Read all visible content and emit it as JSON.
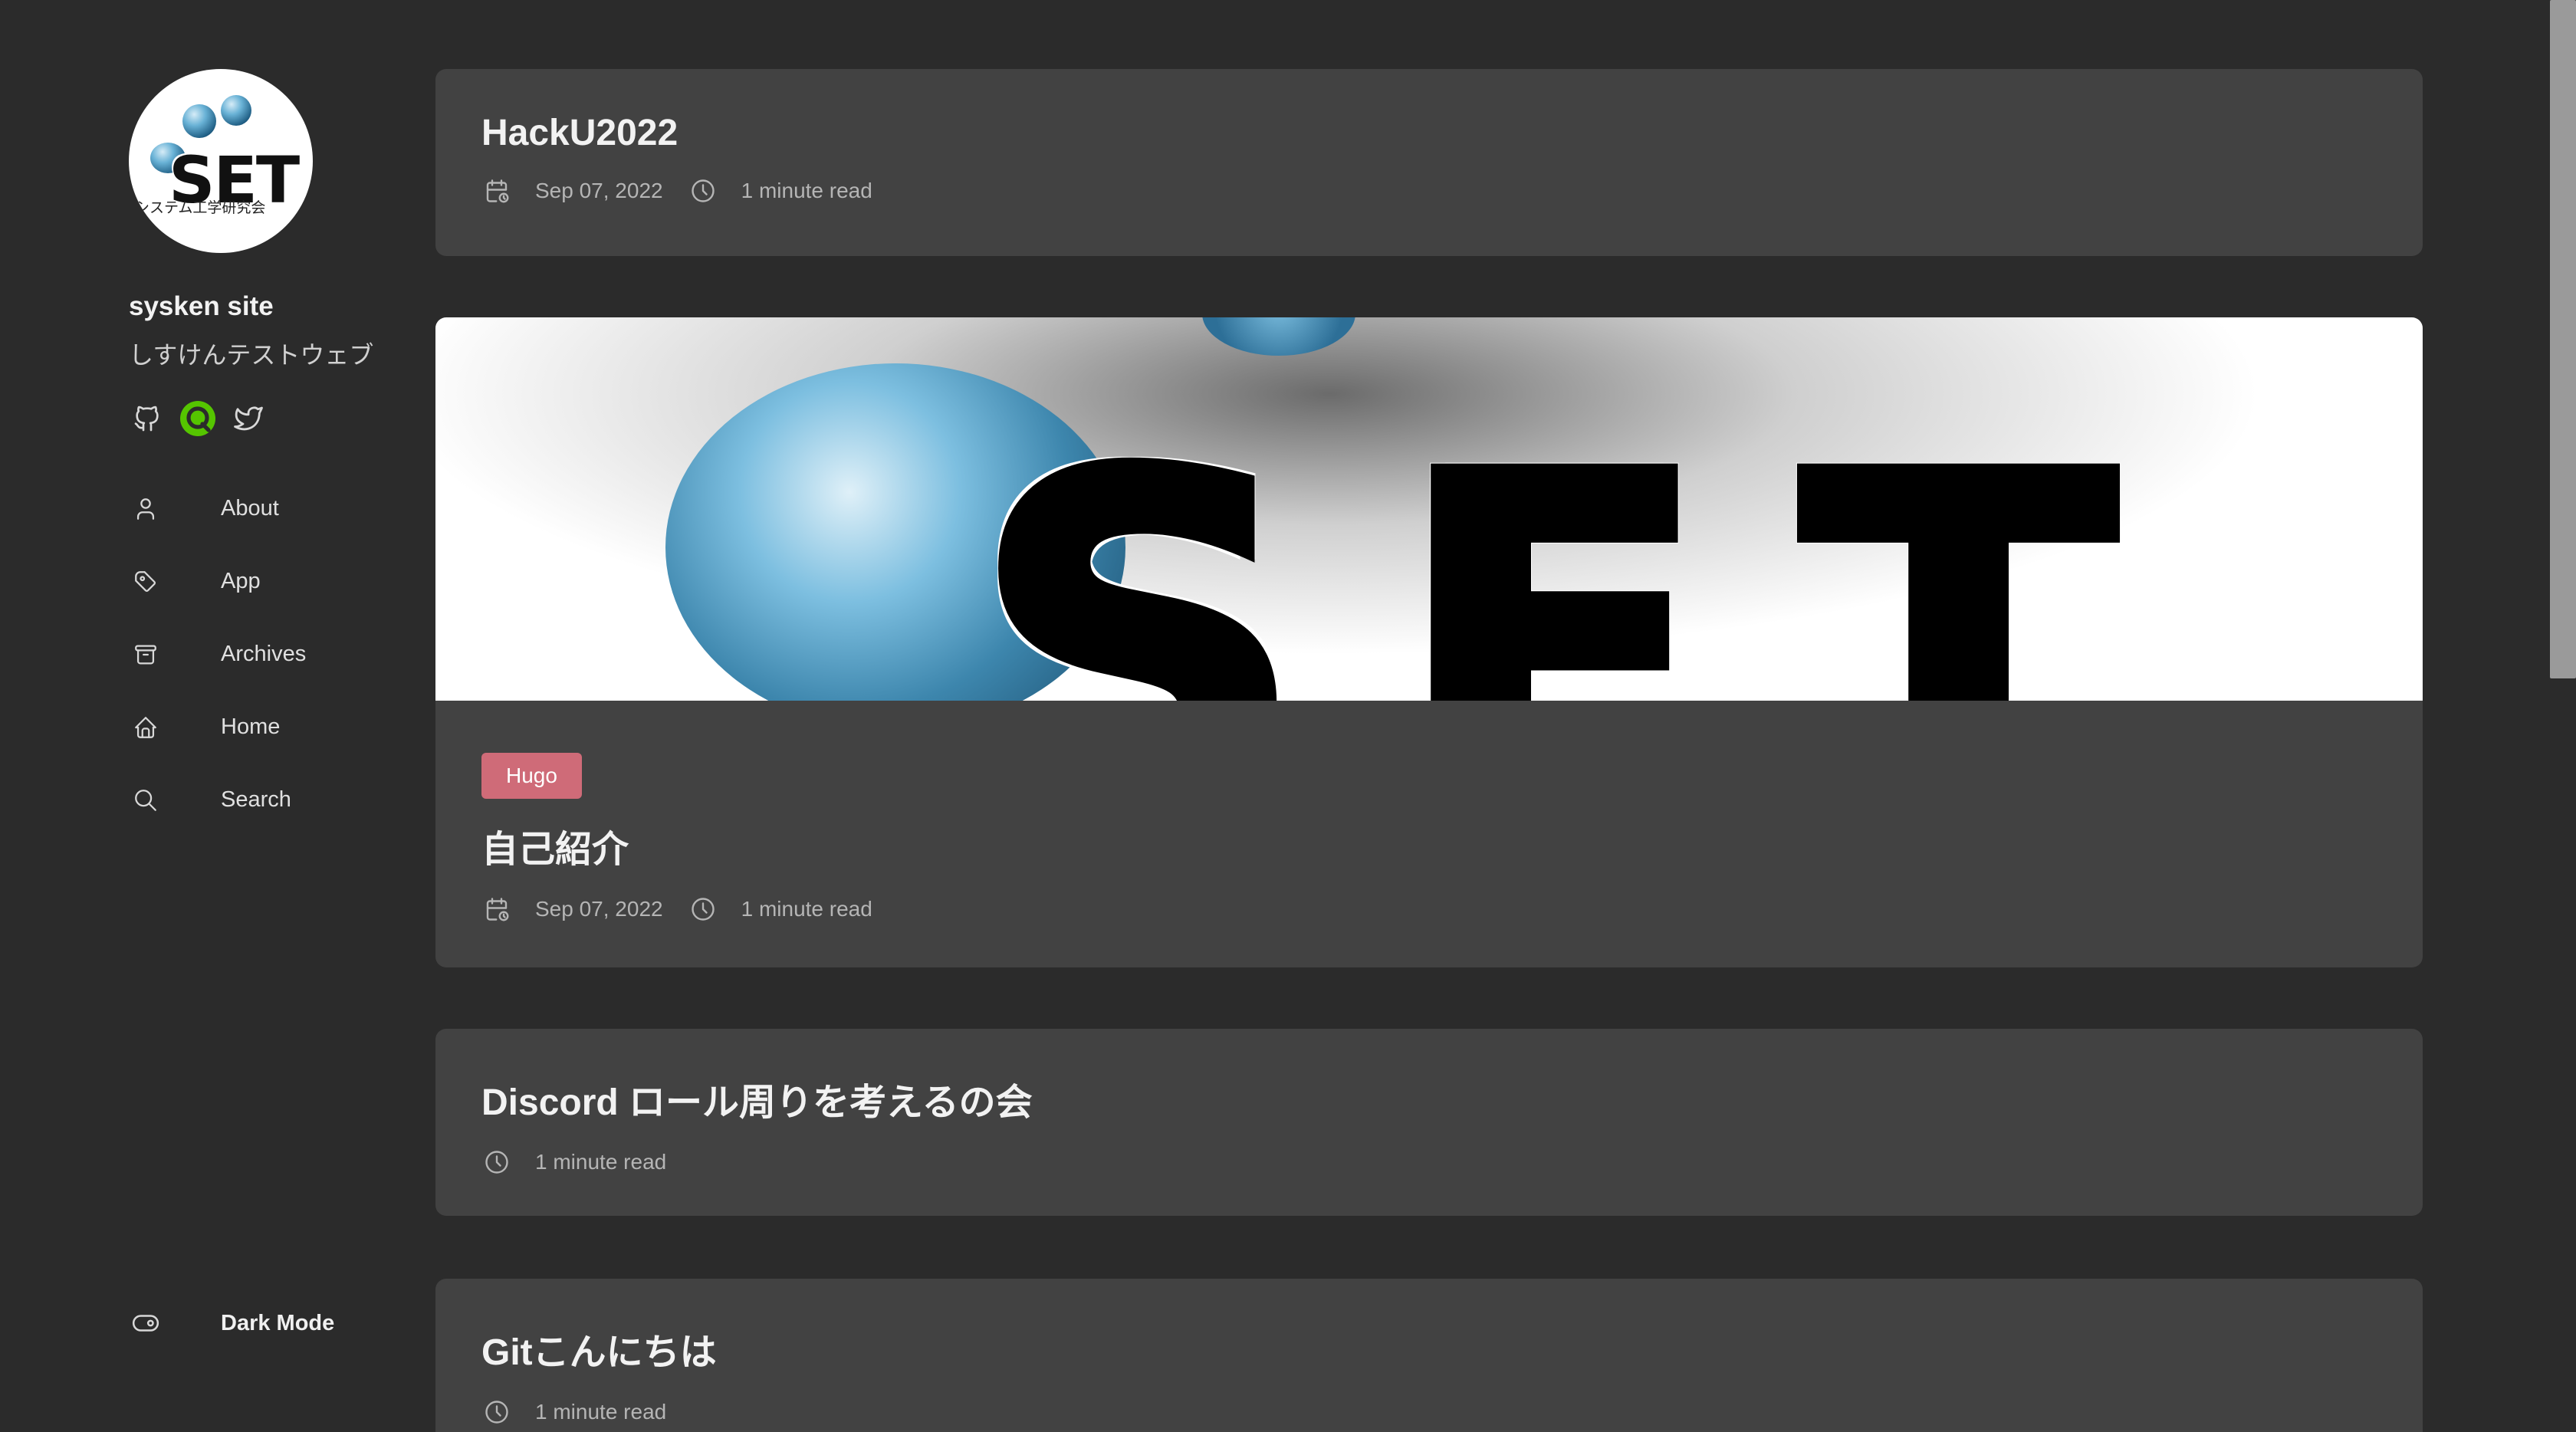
{
  "site": {
    "avatar_logo_text": "SET",
    "avatar_logo_subtext": "システム工学研究会",
    "name": "sysken site",
    "description": "しすけんテストウェブ"
  },
  "social": [
    {
      "icon": "github-icon"
    },
    {
      "icon": "qiita-icon",
      "color": "#55c500"
    },
    {
      "icon": "twitter-icon"
    }
  ],
  "nav": [
    {
      "label": "About",
      "icon": "user-icon"
    },
    {
      "label": "App",
      "icon": "tag-icon"
    },
    {
      "label": "Archives",
      "icon": "archive-icon"
    },
    {
      "label": "Home",
      "icon": "home-icon"
    },
    {
      "label": "Search",
      "icon": "search-icon"
    }
  ],
  "dark_mode": {
    "label": "Dark Mode",
    "icon": "toggle-icon"
  },
  "posts": [
    {
      "title": "HackU2022",
      "date": "Sep 07, 2022",
      "read_time": "1 minute read"
    },
    {
      "image_text": "SET",
      "tag": "Hugo",
      "title": "自己紹介",
      "date": "Sep 07, 2022",
      "read_time": "1 minute read"
    },
    {
      "title": "Discord ロール周りを考えるの会",
      "read_time": "1 minute read"
    },
    {
      "title": "Gitこんにちは",
      "read_time": "1 minute read"
    }
  ],
  "colors": {
    "background": "#2b2b2b",
    "card": "#424242",
    "tag": "#cf6b78",
    "accent_green": "#55c500"
  }
}
